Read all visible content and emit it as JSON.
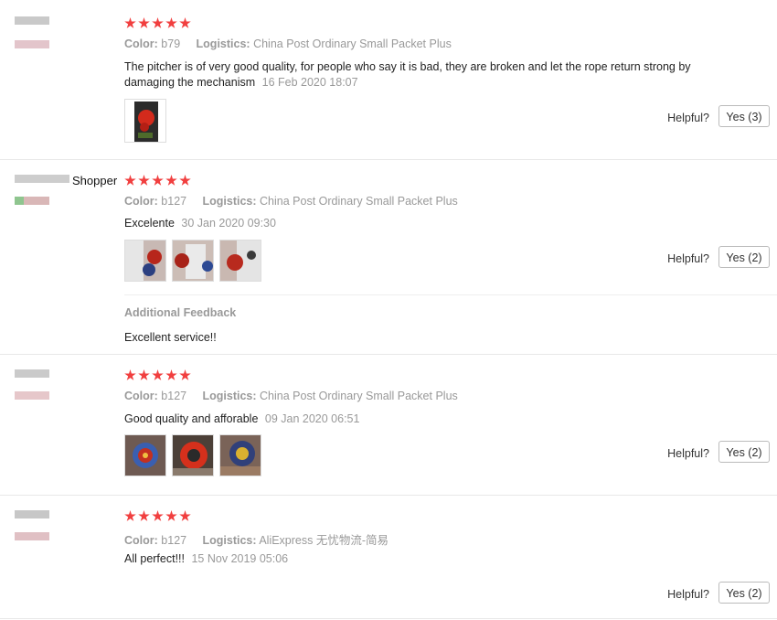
{
  "reviews": [
    {
      "rating": 5,
      "color_label": "Color:",
      "color_value": "b79",
      "logistics_label": "Logistics:",
      "logistics_value": "China Post Ordinary Small Packet Plus",
      "text": "The pitcher is of very good quality, for people who say it is bad, they are broken and let the rope return strong by damaging the mechanism",
      "date": "16 Feb 2020 18:07",
      "photos": 1,
      "helpful_label": "Helpful?",
      "yes_label": "Yes (3)"
    },
    {
      "shopper_label": "Shopper",
      "rating": 5,
      "color_label": "Color:",
      "color_value": "b127",
      "logistics_label": "Logistics:",
      "logistics_value": "China Post Ordinary Small Packet Plus",
      "text": "Excelente",
      "date": "30 Jan 2020 09:30",
      "photos": 3,
      "helpful_label": "Helpful?",
      "yes_label": "Yes (2)",
      "additional_feedback_title": "Additional Feedback",
      "additional_feedback_text": "Excellent service!!"
    },
    {
      "rating": 5,
      "color_label": "Color:",
      "color_value": "b127",
      "logistics_label": "Logistics:",
      "logistics_value": "China Post Ordinary Small Packet Plus",
      "text": "Good quality and afforable",
      "date": "09 Jan 2020 06:51",
      "photos": 3,
      "helpful_label": "Helpful?",
      "yes_label": "Yes (2)"
    },
    {
      "rating": 5,
      "color_label": "Color:",
      "color_value": "b127",
      "logistics_label": "Logistics:",
      "logistics_value": "AliExpress 无忧物流-简易",
      "text": "All perfect!!!",
      "date": "15 Nov 2019 05:06",
      "photos": 0,
      "helpful_label": "Helpful?",
      "yes_label": "Yes (2)"
    }
  ],
  "colors": {
    "star": "#f13f3f",
    "muted": "#999999",
    "border": "#e8e8e8"
  }
}
